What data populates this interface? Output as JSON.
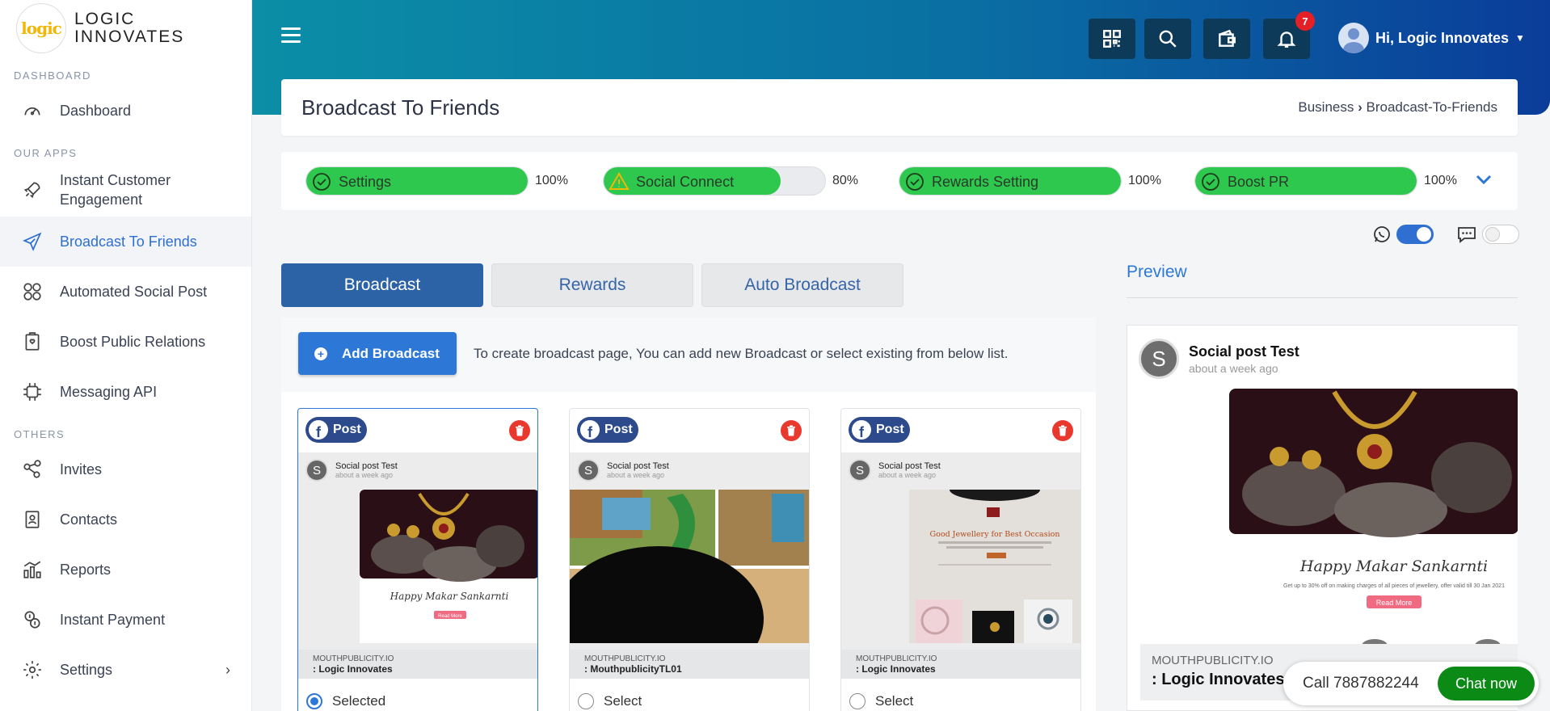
{
  "brand": {
    "logo_text": "logic",
    "name_line1": "LOGIC",
    "name_line2": "INNOVATES"
  },
  "sidebar": {
    "sections": [
      "DASHBOARD",
      "OUR APPS",
      "OTHERS"
    ],
    "items": [
      {
        "label": "Dashboard",
        "icon": "gauge-icon"
      },
      {
        "label": "Instant Customer Engagement",
        "icon": "rocket-icon"
      },
      {
        "label": "Broadcast To Friends",
        "icon": "paper-plane-icon",
        "active": true
      },
      {
        "label": "Automated Social Post",
        "icon": "social-grid-icon"
      },
      {
        "label": "Boost Public Relations",
        "icon": "clipboard-icon"
      },
      {
        "label": "Messaging API",
        "icon": "api-chip-icon"
      },
      {
        "label": "Invites",
        "icon": "share-nodes-icon"
      },
      {
        "label": "Contacts",
        "icon": "contact-book-icon"
      },
      {
        "label": "Reports",
        "icon": "bar-chart-icon"
      },
      {
        "label": "Instant Payment",
        "icon": "coins-icon"
      },
      {
        "label": "Settings",
        "icon": "gear-icon"
      }
    ]
  },
  "header": {
    "notification_count": "7",
    "user_greeting": "Hi, Logic Innovates"
  },
  "page": {
    "title": "Broadcast To Friends",
    "breadcrumb_parent": "Business",
    "breadcrumb_current": "Broadcast-To-Friends"
  },
  "progress": [
    {
      "label": "Settings",
      "percent": "100%",
      "value": 100,
      "status": "complete"
    },
    {
      "label": "Social Connect",
      "percent": "80%",
      "value": 80,
      "status": "warning"
    },
    {
      "label": "Rewards Setting",
      "percent": "100%",
      "value": 100,
      "status": "complete"
    },
    {
      "label": "Boost PR",
      "percent": "100%",
      "value": 100,
      "status": "complete"
    }
  ],
  "toggles": {
    "whatsapp": true,
    "sms": false
  },
  "tabs": [
    {
      "label": "Broadcast",
      "active": true
    },
    {
      "label": "Rewards",
      "active": false
    },
    {
      "label": "Auto Broadcast",
      "active": false
    }
  ],
  "broadcast": {
    "add_label": "Add Broadcast",
    "hint": "To create broadcast page, You can add new Broadcast or select existing from below list.",
    "post_badge": "Post",
    "cards": [
      {
        "avatar": "S",
        "name": "Social post Test",
        "time": "about a week ago",
        "domain": "MOUTHPUBLICITY.IO",
        "account": ": Logic Innovates",
        "select_label": "Selected",
        "selected": true,
        "img_headline": "Happy Makar Sankarnti",
        "img_button": "Read More"
      },
      {
        "avatar": "S",
        "name": "Social post Test",
        "time": "about a week ago",
        "domain": "MOUTHPUBLICITY.IO",
        "account": ": MouthpublicityTL01",
        "select_label": "Select",
        "selected": false
      },
      {
        "avatar": "S",
        "name": "Social post Test",
        "time": "about a week ago",
        "domain": "MOUTHPUBLICITY.IO",
        "account": ": Logic Innovates",
        "select_label": "Select",
        "selected": false,
        "img_headline": "Good Jewellery for Best Occasion"
      }
    ]
  },
  "preview": {
    "title": "Preview",
    "avatar": "S",
    "name": "Social post Test",
    "time": "about a week ago",
    "img_headline": "Happy Makar Sankarnti",
    "img_sub": "Get up to 30% off on making charges of all pieces of jewellery, offer valid till 30 Jan 2021",
    "img_button": "Read More",
    "domain": "MOUTHPUBLICITY.IO",
    "account": ": Logic Innovates"
  },
  "call_widget": {
    "call_text": "Call 7887882244",
    "chat_label": "Chat now"
  },
  "colors": {
    "accent": "#2d78d6",
    "success": "#2fc84e",
    "header_start": "#0b8ea6",
    "header_end": "#0a3d9a",
    "chat": "#0c8a16"
  }
}
